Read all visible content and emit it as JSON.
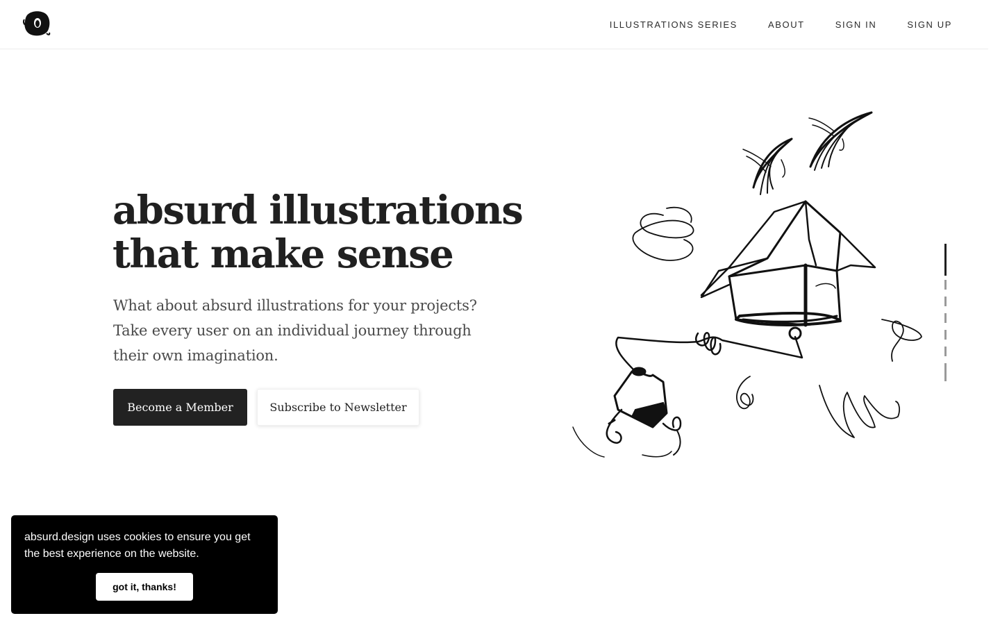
{
  "header": {
    "logo_icon": "ink-blob-logo-icon",
    "nav": [
      {
        "label": "ILLUSTRATIONS SERIES"
      },
      {
        "label": "ABOUT"
      },
      {
        "label": "SIGN IN"
      },
      {
        "label": "SIGN UP"
      }
    ]
  },
  "hero": {
    "title_line1": "absurd illustrations",
    "title_line2": "that make sense",
    "description": "What about absurd illustrations for your projects? Take every user on an individual journey through their own imagination.",
    "primary_button": "Become a Member",
    "secondary_button": "Subscribe to Newsletter",
    "illustration_icon": "flying-box-sketch-icon"
  },
  "slider": {
    "total_slides": 6,
    "active_slide": 1
  },
  "cookie_banner": {
    "text": "absurd.design uses cookies to ensure you get the best experience on the website.",
    "button": "got it, thanks!"
  },
  "colors": {
    "text": "#1f1f1f",
    "primary_button_bg": "#222222",
    "cookie_bg": "#000000",
    "page_bg": "#ffffff"
  }
}
